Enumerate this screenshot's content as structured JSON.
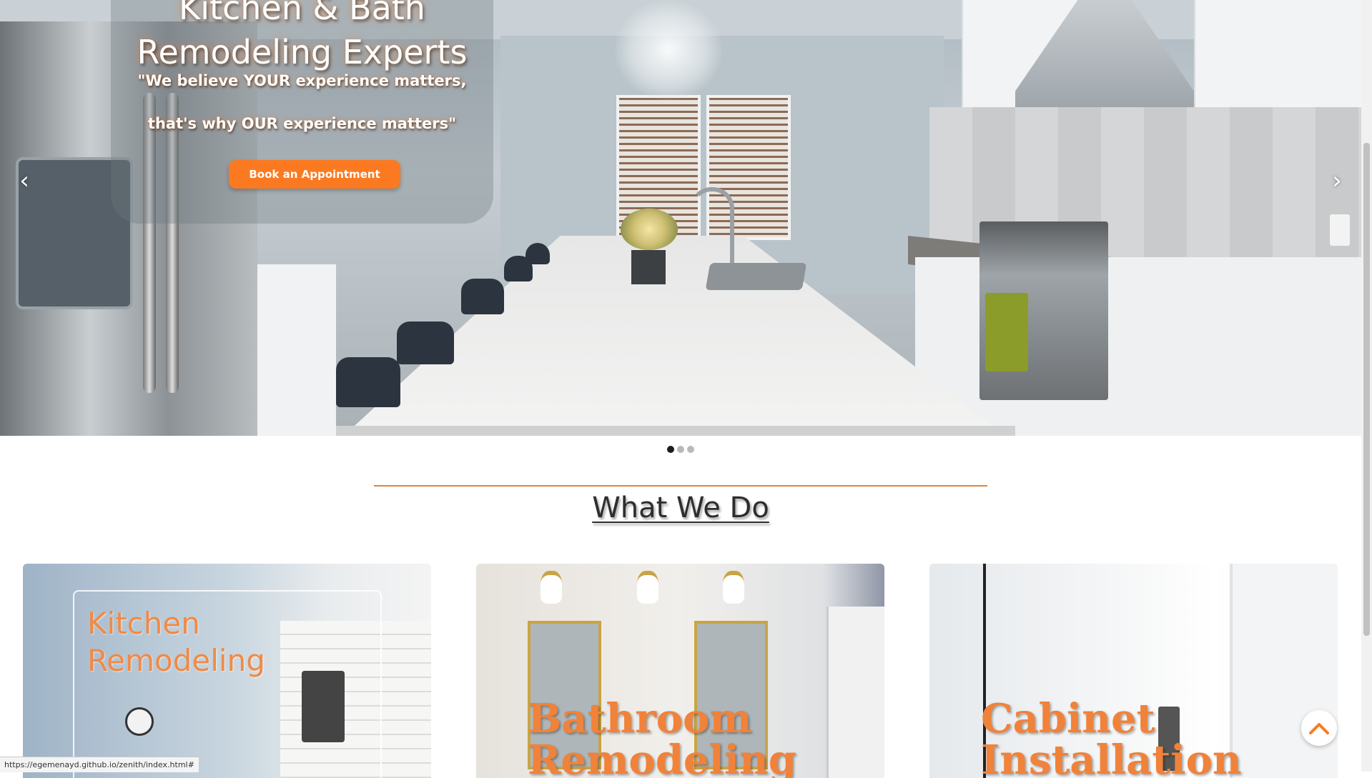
{
  "hero": {
    "title_line1": "Kitchen & Bath",
    "title_line2": "Remodeling Experts",
    "quote_line1": "\"We believe YOUR experience matters,",
    "quote_line2": "that's why OUR experience matters\"",
    "book_button": "Book an Appointment",
    "prev_icon": "chevron-left-icon",
    "next_icon": "chevron-right-icon",
    "prev_glyph": "‹",
    "next_glyph": "›",
    "slide_count": 3,
    "active_slide": 1
  },
  "section": {
    "title": "What We Do",
    "accent_color": "#d9853b"
  },
  "services": [
    {
      "title_line1": "Kitchen",
      "title_line2": "Remodeling"
    },
    {
      "title_line1": "Bathroom",
      "title_line2": "Remodeling"
    },
    {
      "title_line1": "Cabinet",
      "title_line2": "Installation"
    }
  ],
  "back_to_top": {
    "icon": "chevron-up-icon",
    "color": "#fb7a21"
  },
  "status_bar": {
    "url": "https://egemenayd.github.io/zenith/index.html#"
  },
  "colors": {
    "brand_orange": "#fb7a21",
    "title_orange": "#f0823a"
  }
}
